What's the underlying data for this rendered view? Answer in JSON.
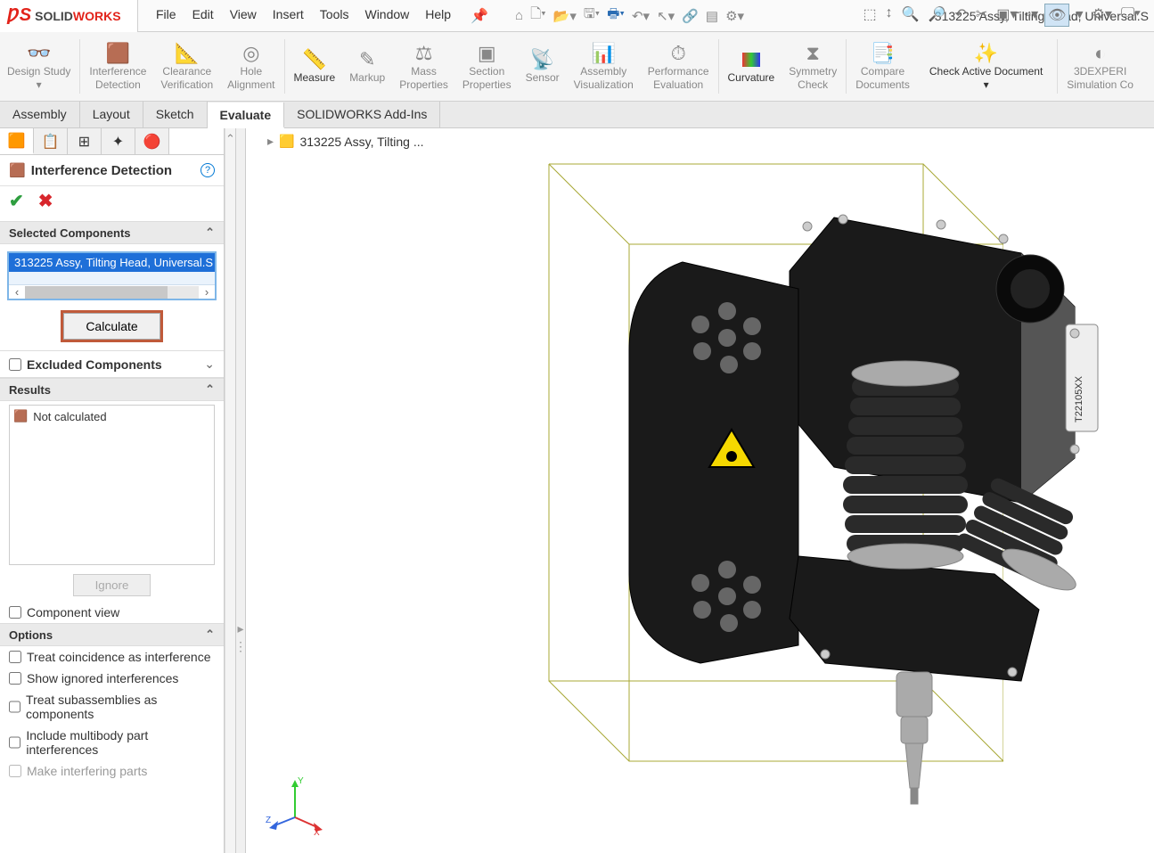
{
  "app": {
    "brand_solid": "SOLID",
    "brand_works": "WORKS"
  },
  "menus": [
    "File",
    "Edit",
    "View",
    "Insert",
    "Tools",
    "Window",
    "Help"
  ],
  "doc_title": "313225 Assy, Tilting Head, Universal.S",
  "ribbon": {
    "design_study": "Design Study",
    "interference": "Interference\nDetection",
    "clearance": "Clearance\nVerification",
    "hole": "Hole\nAlignment",
    "measure": "Measure",
    "markup": "Markup",
    "mass": "Mass\nProperties",
    "section": "Section\nProperties",
    "sensor": "Sensor",
    "assy_vis": "Assembly\nVisualization",
    "perf": "Performance\nEvaluation",
    "curvature": "Curvature",
    "symmetry": "Symmetry\nCheck",
    "compare": "Compare\nDocuments",
    "check_active": "Check Active Document",
    "3dexp": "3DEXPERI\nSimulation Co"
  },
  "tabs": [
    "Assembly",
    "Layout",
    "Sketch",
    "Evaluate",
    "SOLIDWORKS Add-Ins"
  ],
  "panel": {
    "title": "Interference Detection",
    "selected_components": "Selected Components",
    "selected_item": "313225 Assy, Tilting Head, Universal.S",
    "calculate": "Calculate",
    "excluded": "Excluded Components",
    "results": "Results",
    "not_calculated": "Not calculated",
    "ignore": "Ignore",
    "component_view": "Component view",
    "options": "Options",
    "opt_coincidence": "Treat coincidence as interference",
    "opt_ignored": "Show ignored interferences",
    "opt_subasm": "Treat subassemblies as components",
    "opt_multibody": "Include multibody part interferences",
    "opt_interfering": "Make interfering parts"
  },
  "breadcrumb": "313225 Assy, Tilting ..."
}
